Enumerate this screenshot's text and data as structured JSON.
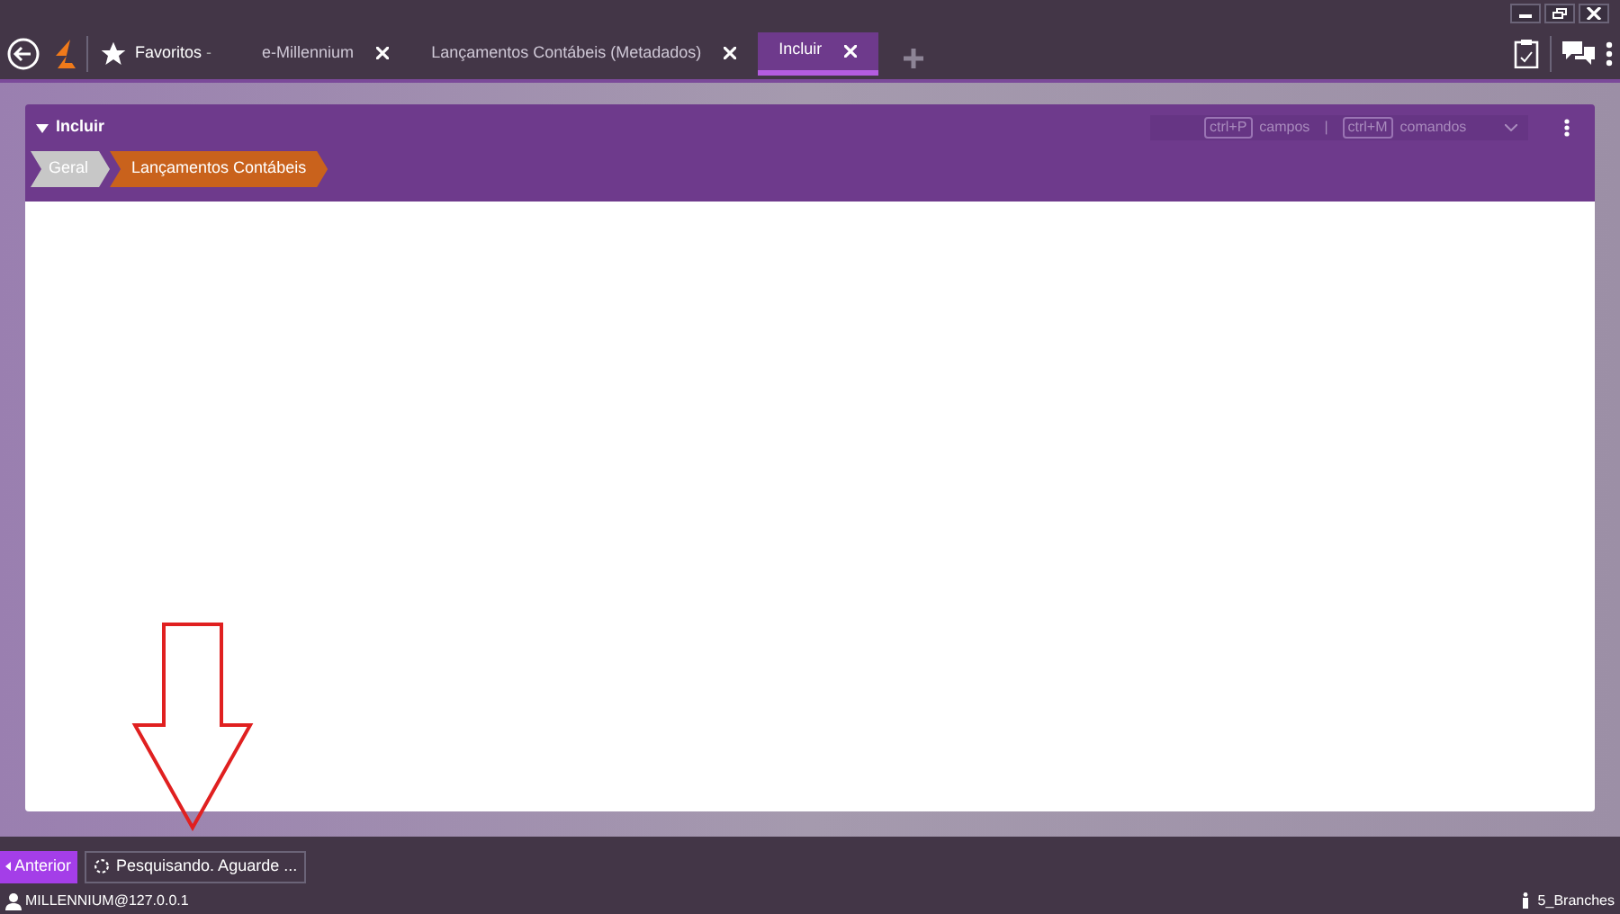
{
  "toolbar": {
    "favorites": "Favoritos",
    "favorites_caret": "-"
  },
  "tabs": [
    {
      "label": "e-Millennium",
      "selected": false
    },
    {
      "label": "Lançamentos Contábeis (Metadados)",
      "selected": false
    },
    {
      "label": "Incluir",
      "selected": true
    }
  ],
  "panel": {
    "title": "Incluir",
    "shortcuts": [
      {
        "key": "ctrl+P",
        "label": "campos"
      },
      {
        "key": "ctrl+M",
        "label": "comandos"
      }
    ],
    "separator": "|",
    "steps": [
      {
        "label": "Geral",
        "selected": false
      },
      {
        "label": "Lançamentos Contábeis",
        "selected": true
      }
    ]
  },
  "footer": {
    "back_button": "Anterior",
    "status": "Pesquisando. Aguarde ...",
    "user": "MILLENNIUM@127.0.0.1",
    "branch": "5_Branches"
  }
}
